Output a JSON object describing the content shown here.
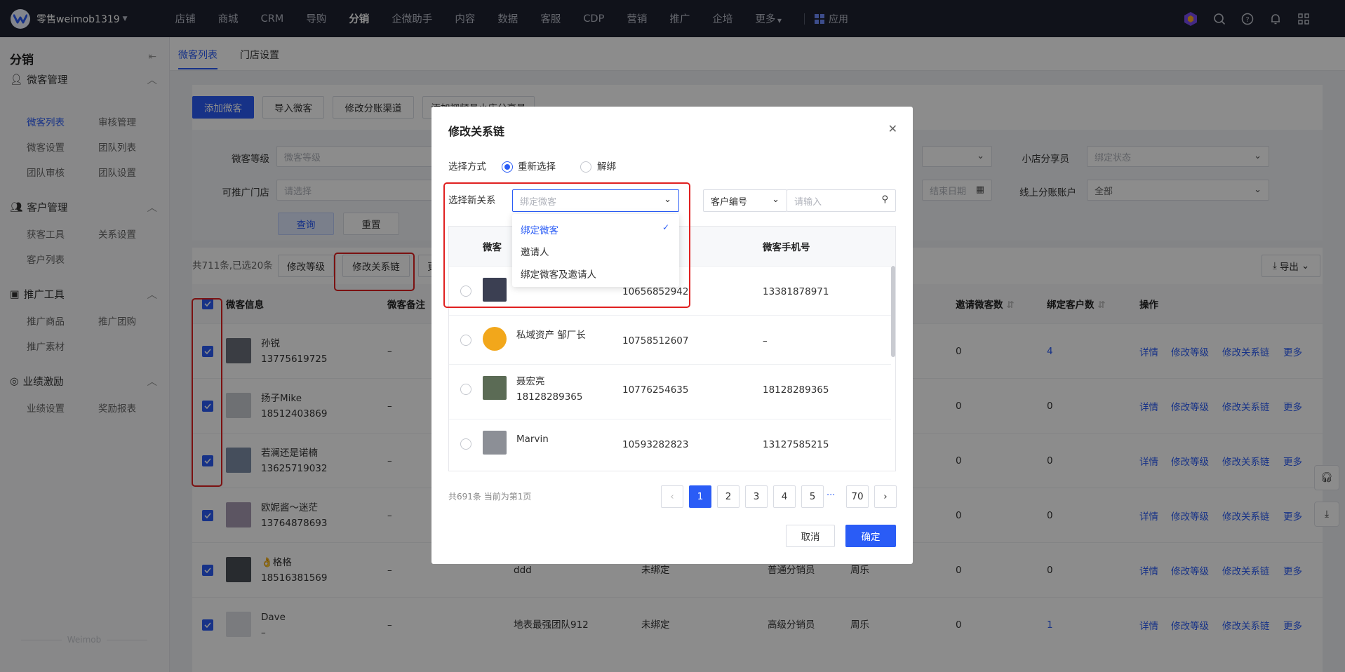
{
  "topbar": {
    "brand": "零售weimob1319",
    "nav": [
      "店铺",
      "商城",
      "CRM",
      "导购",
      "分销",
      "企微助手",
      "内容",
      "数据",
      "客服",
      "CDP",
      "营销",
      "推广",
      "企培",
      "更多"
    ],
    "apps_label": "应用"
  },
  "sidebar": {
    "title": "分销",
    "groups": [
      {
        "label": "微客管理",
        "items": [
          "微客列表",
          "审核管理",
          "微客设置",
          "团队列表",
          "团队审核",
          "团队设置"
        ]
      },
      {
        "label": "客户管理",
        "items": [
          "获客工具",
          "关系设置",
          "客户列表"
        ]
      },
      {
        "label": "推广工具",
        "items": [
          "推广商品",
          "推广团购",
          "推广素材"
        ]
      },
      {
        "label": "业绩激励",
        "items": [
          "业绩设置",
          "奖励报表"
        ]
      }
    ],
    "watermark": "Weimob"
  },
  "tabs": [
    "微客列表",
    "门店设置"
  ],
  "toolbar": {
    "add": "添加微客",
    "import": "导入微客",
    "channel": "修改分账渠道",
    "video": "添加视频号小店分享员"
  },
  "filters": {
    "level_label": "微客等级",
    "level_placeholder": "微客等级",
    "share_label": "小店分享员",
    "share_placeholder": "绑定状态",
    "store_label": "可推广门店",
    "store_placeholder": "请选择",
    "end_date": "结束日期",
    "account_label": "线上分账账户",
    "account_value": "全部",
    "query": "查询",
    "reset": "重置"
  },
  "list": {
    "summary": "共711条,已选20条",
    "edit_level": "修改等级",
    "edit_chain": "修改关系链",
    "export": "导出",
    "headers": {
      "info": "微客信息",
      "note": "微客备注",
      "invites": "邀请微客数",
      "bound": "绑定客户数",
      "ops": "操作"
    },
    "ops": [
      "详情",
      "修改等级",
      "修改关系链",
      "更多"
    ],
    "rows": [
      {
        "name": "孙锐",
        "phone": "13775619725",
        "note": "–",
        "team": "",
        "bind": "",
        "level": "",
        "inviter": "",
        "invites": "0",
        "bound": "4"
      },
      {
        "name": "扬子Mike",
        "phone": "18512403869",
        "note": "–",
        "team": "",
        "bind": "",
        "level": "",
        "inviter": "",
        "invites": "0",
        "bound": "0"
      },
      {
        "name": "若澜还是诺楠",
        "phone": "13625719032",
        "note": "–",
        "team": "",
        "bind": "",
        "level": "",
        "inviter": "",
        "invites": "0",
        "bound": "0"
      },
      {
        "name": "欧妮酱～迷茫",
        "phone": "13764878693",
        "note": "–",
        "team": "",
        "bind": "",
        "level": "",
        "inviter": "",
        "invites": "0",
        "bound": "0"
      },
      {
        "name": "👌格格",
        "phone": "18516381569",
        "note": "–",
        "team": "ddd",
        "bind": "未绑定",
        "level": "普通分销员",
        "inviter": "周乐",
        "invites": "0",
        "bound": "0"
      },
      {
        "name": "Dave",
        "phone": "–",
        "note": "–",
        "team": "地表最强团队912",
        "bind": "未绑定",
        "level": "高级分销员",
        "inviter": "周乐",
        "invites": "0",
        "bound": "1"
      }
    ]
  },
  "modal": {
    "title": "修改关系链",
    "method_label": "选择方式",
    "opt_reselect": "重新选择",
    "opt_unbind": "解绑",
    "new_rel_label": "选择新关系",
    "select_placeholder": "绑定微客",
    "search_field": "客户编号",
    "search_placeholder": "请输入",
    "dropdown": [
      "绑定微客",
      "邀请人",
      "绑定微客及邀请人"
    ],
    "table_headers": {
      "user": "微客",
      "phone": "微客手机号"
    },
    "rows": [
      {
        "name": "",
        "phone2": "",
        "id": "10656852942",
        "mobile": "13381878971"
      },
      {
        "name": "私域资产 邹厂长",
        "phone2": "",
        "id": "10758512607",
        "mobile": "–"
      },
      {
        "name": "聂宏亮",
        "phone2": "18128289365",
        "id": "10776254635",
        "mobile": "18128289365"
      },
      {
        "name": "Marvin",
        "phone2": "",
        "id": "10593282823",
        "mobile": "13127585215"
      }
    ],
    "total": "共691条 当前为第1页",
    "pages": [
      "1",
      "2",
      "3",
      "4",
      "5",
      "70"
    ],
    "ellipsis": "···",
    "cancel": "取消",
    "confirm": "确定"
  }
}
